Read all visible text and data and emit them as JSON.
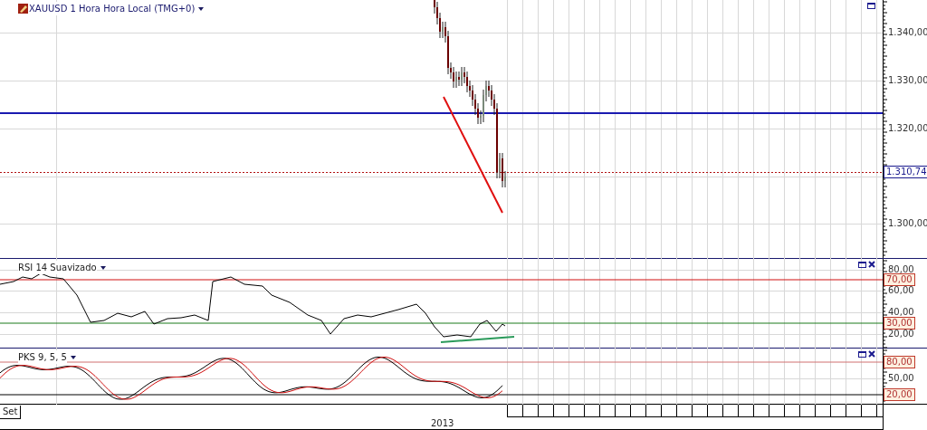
{
  "chart": {
    "title": "XAUUSD 1 Hora Hora Local (TMG+0)",
    "price_axis": [
      "1.340,00",
      "1.330,00",
      "1.320,00",
      "1.300,00"
    ],
    "last_price": "1.310,74"
  },
  "rsi": {
    "title": "RSI 14 Suavizado",
    "axis": [
      "80,00",
      "60,00",
      "40,00",
      "20,00"
    ],
    "levels": [
      "70,00",
      "30,00"
    ]
  },
  "pks": {
    "title": "PKS 9, 5, 5",
    "axis": [
      "50,00"
    ],
    "levels": [
      "80,00",
      "20,00"
    ]
  },
  "time_axis": {
    "labels": [
      "Set",
      "2013"
    ]
  }
}
